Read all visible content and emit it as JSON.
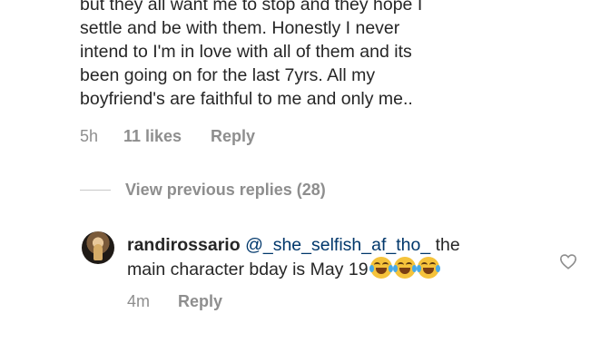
{
  "comment": {
    "lines": [
      "but they all want me to stop and they hope I",
      "settle and be with them. Honestly I never",
      "intend to I'm in love with all of them and its",
      "been going on for the last 7yrs. All my",
      "boyfriend's are faithful to me and only me.."
    ],
    "time": "5h",
    "likes": "11 likes",
    "reply_label": "Reply"
  },
  "view_previous": "View previous replies (28)",
  "reply": {
    "username": "randirossario",
    "mention": "@_she_selfish_af_tho_",
    "text_part1": " the",
    "text_line2": "main character bday is May 19",
    "emoji_name": "face-with-tears-of-joy-icon",
    "time": "4m",
    "reply_label": "Reply"
  },
  "colors": {
    "text": "#262626",
    "muted": "#8e8e8e",
    "mention": "#00376b"
  }
}
